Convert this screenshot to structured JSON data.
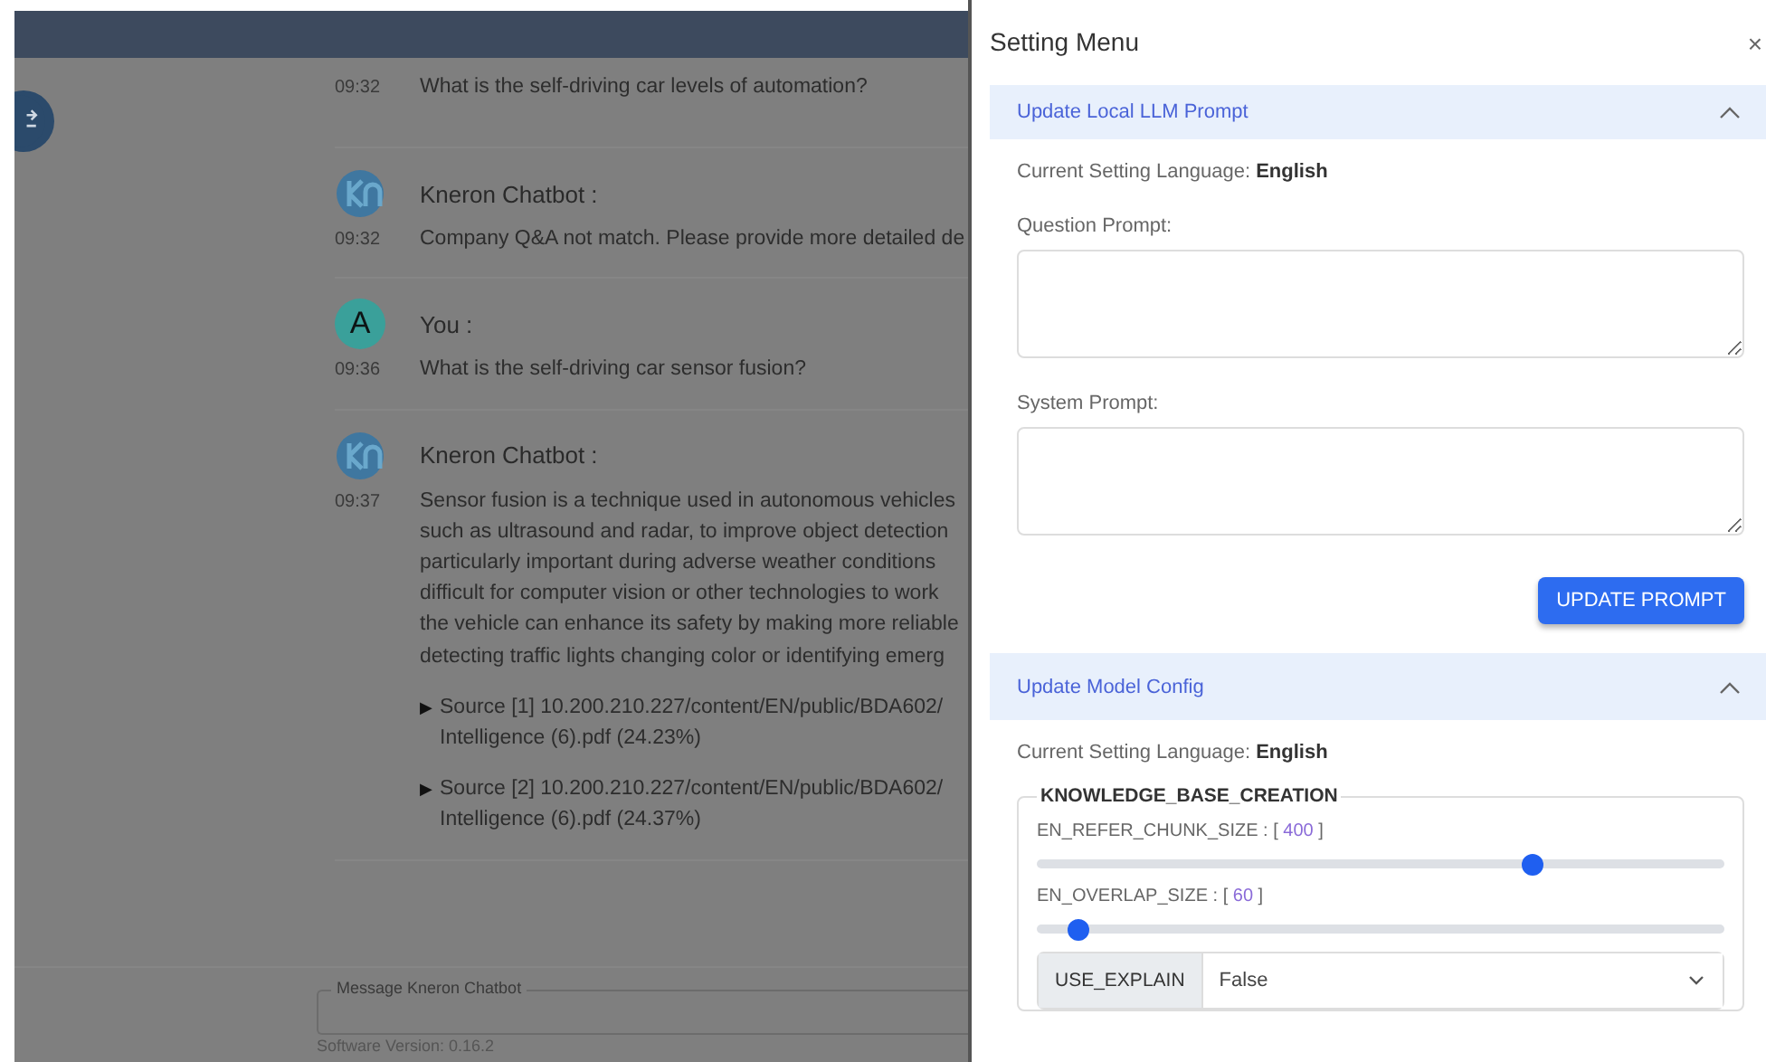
{
  "chat": {
    "messages": [
      {
        "time": "09:32",
        "lines": [
          "What is the self-driving car levels of automation?"
        ]
      },
      {
        "kind": "bot",
        "name": "Kneron Chatbot :",
        "time": "09:32",
        "lines": [
          "Company Q&A not match. Please provide more detailed de"
        ]
      },
      {
        "kind": "user",
        "initial": "A",
        "name": "You :",
        "time": "09:36",
        "lines": [
          "What is the self-driving car sensor fusion?"
        ]
      },
      {
        "kind": "bot",
        "name": "Kneron Chatbot :",
        "time": "09:37",
        "lines": [
          "Sensor fusion is a technique used in autonomous vehicles",
          "such as ultrasound and radar, to improve object detection",
          "particularly important during adverse weather conditions",
          "difficult for computer vision or other technologies to work",
          "the vehicle can enhance its safety by making more reliable",
          "detecting traffic lights changing color or identifying emerg"
        ],
        "sources": [
          {
            "marker": "▶",
            "lines": [
              "Source [1] 10.200.210.227/content/EN/public/BDA602/",
              "Intelligence (6).pdf (24.23%)"
            ]
          },
          {
            "marker": "▶",
            "lines": [
              "Source [2] 10.200.210.227/content/EN/public/BDA602/",
              "Intelligence (6).pdf (24.37%)"
            ]
          }
        ]
      }
    ],
    "input": {
      "label": "Message Kneron Chatbot"
    },
    "version": "Software Version: 0.16.2"
  },
  "panel": {
    "title": "Setting Menu",
    "close": "×",
    "sections": [
      {
        "kind": "prompt",
        "title": "Update Local LLM Prompt",
        "expanded": true,
        "language": "Current Setting Language: **English**",
        "fields": [
          {
            "label": "Question Prompt:"
          },
          {
            "label": "System Prompt:"
          }
        ],
        "button": "UPDATE PROMPT"
      },
      {
        "kind": "config",
        "title": "Update Model Config",
        "expanded": true,
        "language": "Current Setting Language: **English**",
        "group": {
          "legend": "KNOWLEDGE_BASE_CREATION",
          "sliders": [
            {
              "prefix": "EN_REFER_CHUNK_SIZE : [",
              "value": "400",
              "suffix": "]",
              "level": 0.72
            },
            {
              "prefix": "EN_OVERLAP_SIZE : [",
              "value": "60",
              "suffix": "]",
              "level": 0.06
            }
          ],
          "select": {
            "label": "USE_EXPLAIN",
            "value": "False"
          }
        }
      }
    ]
  }
}
